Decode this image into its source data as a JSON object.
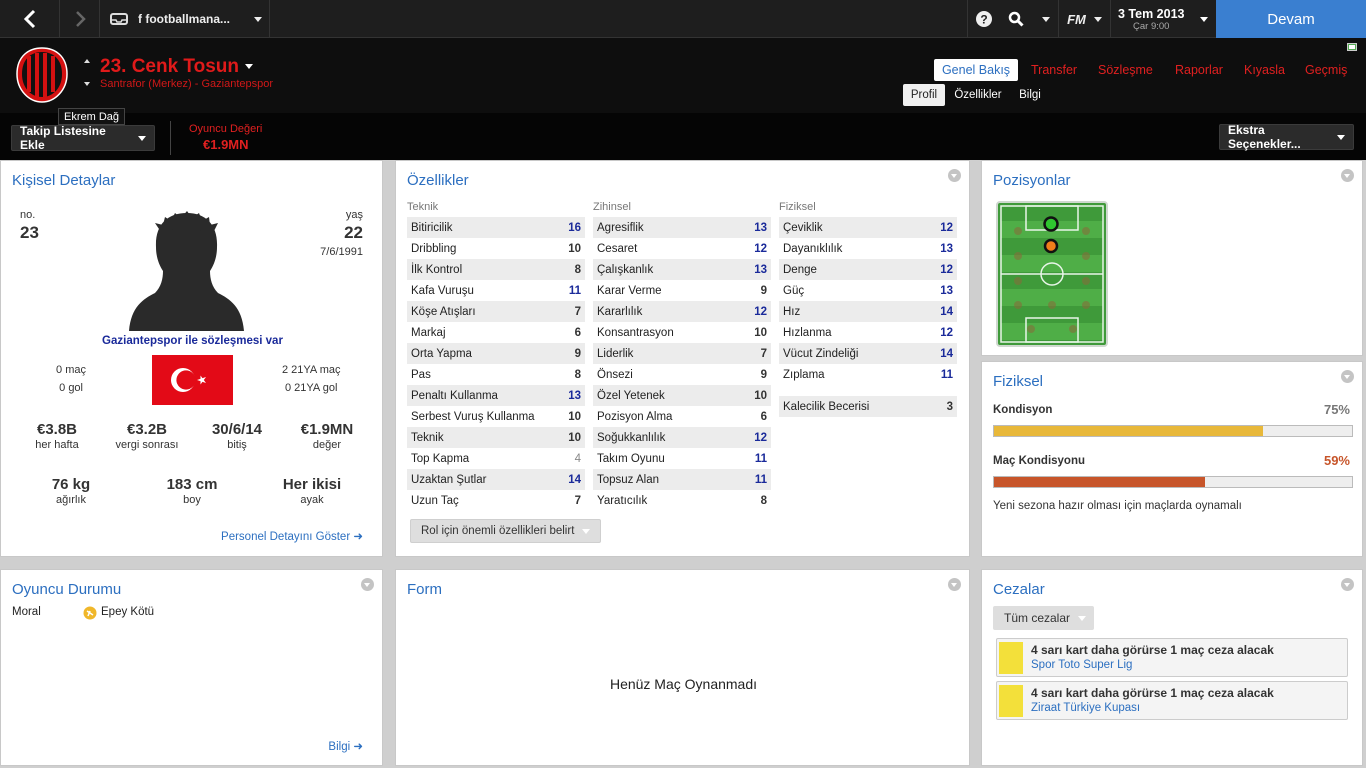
{
  "topbar": {
    "tab_title": "f footballmana...",
    "date": "3 Tem 2013",
    "time": "Çar 9:00",
    "fm_label": "FM",
    "continue_label": "Devam"
  },
  "header": {
    "player_name": "23. Cenk Tosun",
    "player_subtitle": "Santrafor (Merkez) - Gaziantepspor",
    "tooltip": "Ekrem Dağ",
    "nav": [
      "Genel Bakış",
      "Transfer",
      "Sözleşme",
      "Raporlar",
      "Kıyasla",
      "Geçmiş"
    ],
    "subtabs": [
      "Profil",
      "Özellikler",
      "Bilgi"
    ]
  },
  "actionbar": {
    "shortlist_label": "Takip Listesine Ekle",
    "value_label": "Oyuncu Değeri",
    "value": "€1.9MN",
    "extra_label": "Ekstra Seçenekler..."
  },
  "personal": {
    "title": "Kişisel Detaylar",
    "no_label": "no.",
    "no": "23",
    "age_label": "yaş",
    "age": "22",
    "dob": "7/6/1991",
    "contract": "Gaziantepspor ile sözleşmesi var",
    "caps": "0 maç",
    "goals": "0 gol",
    "u21_caps": "2 21YA maç",
    "u21_goals": "0 21YA gol",
    "wage": "€3.8B",
    "wage_label": "her hafta",
    "after_tax": "€3.2B",
    "after_tax_label": "vergi sonrası",
    "expires": "30/6/14",
    "expires_label": "bitiş",
    "value": "€1.9MN",
    "value_label": "değer",
    "weight": "76 kg",
    "weight_label": "ağırlık",
    "height": "183 cm",
    "height_label": "boy",
    "foot": "Her ikisi",
    "foot_label": "ayak",
    "link": "Personel Detayını Göster"
  },
  "attributes": {
    "title": "Özellikler",
    "technical_head": "Teknik",
    "mental_head": "Zihinsel",
    "physical_head": "Fiziksel",
    "technical": [
      {
        "name": "Bitiricilik",
        "value": "16"
      },
      {
        "name": "Dribbling",
        "value": "10"
      },
      {
        "name": "İlk Kontrol",
        "value": "8"
      },
      {
        "name": "Kafa Vuruşu",
        "value": "11"
      },
      {
        "name": "Köşe Atışları",
        "value": "7"
      },
      {
        "name": "Markaj",
        "value": "6"
      },
      {
        "name": "Orta Yapma",
        "value": "9"
      },
      {
        "name": "Pas",
        "value": "8"
      },
      {
        "name": "Penaltı Kullanma",
        "value": "13"
      },
      {
        "name": "Serbest Vuruş Kullanma",
        "value": "10"
      },
      {
        "name": "Teknik",
        "value": "10"
      },
      {
        "name": "Top Kapma",
        "value": "4"
      },
      {
        "name": "Uzaktan Şutlar",
        "value": "14"
      },
      {
        "name": "Uzun Taç",
        "value": "7"
      }
    ],
    "mental": [
      {
        "name": "Agresiflik",
        "value": "13"
      },
      {
        "name": "Cesaret",
        "value": "12"
      },
      {
        "name": "Çalışkanlık",
        "value": "13"
      },
      {
        "name": "Karar Verme",
        "value": "9"
      },
      {
        "name": "Kararlılık",
        "value": "12"
      },
      {
        "name": "Konsantrasyon",
        "value": "10"
      },
      {
        "name": "Liderlik",
        "value": "7"
      },
      {
        "name": "Önsezi",
        "value": "9"
      },
      {
        "name": "Özel Yetenek",
        "value": "10"
      },
      {
        "name": "Pozisyon Alma",
        "value": "6"
      },
      {
        "name": "Soğukkanlılık",
        "value": "12"
      },
      {
        "name": "Takım Oyunu",
        "value": "11"
      },
      {
        "name": "Topsuz Alan",
        "value": "11"
      },
      {
        "name": "Yaratıcılık",
        "value": "8"
      }
    ],
    "physical": [
      {
        "name": "Çeviklik",
        "value": "12"
      },
      {
        "name": "Dayanıklılık",
        "value": "13"
      },
      {
        "name": "Denge",
        "value": "12"
      },
      {
        "name": "Güç",
        "value": "13"
      },
      {
        "name": "Hız",
        "value": "14"
      },
      {
        "name": "Hızlanma",
        "value": "12"
      },
      {
        "name": "Vücut Zindeliği",
        "value": "14"
      },
      {
        "name": "Zıplama",
        "value": "11"
      }
    ],
    "goalkeeping": {
      "name": "Kalecilik Becerisi",
      "value": "3"
    },
    "role_button": "Rol için önemli özellikleri belirt"
  },
  "positions": {
    "title": "Pozisyonlar"
  },
  "physical_panel": {
    "title": "Fiziksel",
    "condition_label": "Kondisyon",
    "condition_text": "75%",
    "condition": 0.75,
    "match_label": "Maç Kondisyonu",
    "match_text": "59%",
    "match": 0.59,
    "note": "Yeni sezona hazır olması için maçlarda oynamalı",
    "condition_color": "#e8b83a",
    "match_color": "#c7552a"
  },
  "status": {
    "title": "Oyuncu Durumu",
    "morale_label": "Moral",
    "morale_value": "Epey Kötü",
    "link": "Bilgi"
  },
  "form": {
    "title": "Form",
    "empty": "Henüz Maç Oynanmadı"
  },
  "bans": {
    "title": "Cezalar",
    "filter": "Tüm cezalar",
    "items": [
      {
        "text": "4 sarı kart daha görürse 1 maç ceza alacak",
        "comp": "Spor Toto Super Lig"
      },
      {
        "text": "4 sarı kart daha görürse 1 maç ceza alacak",
        "comp": "Ziraat Türkiye Kupası"
      }
    ]
  }
}
